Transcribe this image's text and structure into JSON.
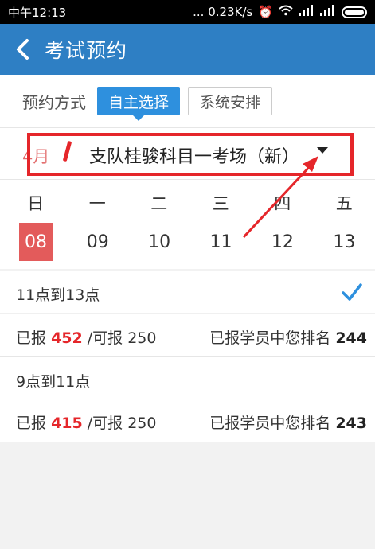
{
  "status_bar": {
    "time": "中午12:13",
    "speed": "... 0.23K/s"
  },
  "app_bar": {
    "title": "考试预约"
  },
  "method": {
    "label": "预约方式",
    "options": [
      "自主选择",
      "系统安排"
    ],
    "selected": "自主选择"
  },
  "venue": {
    "month": "4月",
    "name": "支队桂骏科目一考场（新）"
  },
  "calendar": {
    "weekdays": [
      "日",
      "一",
      "二",
      "三",
      "四",
      "五"
    ],
    "days": [
      "08",
      "09",
      "10",
      "11",
      "12",
      "13"
    ],
    "selected_day": "08"
  },
  "slots": [
    {
      "time": "11点到13点",
      "reported_label": "已报",
      "reported": "452",
      "capacity_label": "/可报 250",
      "rank_label": "已报学员中您排名",
      "rank": "244",
      "selected": true
    },
    {
      "time": "9点到11点",
      "reported_label": "已报",
      "reported": "415",
      "capacity_label": "/可报 250",
      "rank_label": "已报学员中您排名",
      "rank": "243",
      "selected": false
    }
  ],
  "colors": {
    "app_bar": "#2e7fc4",
    "chip_active": "#2e90de",
    "highlight": "#e5262a",
    "selected_day": "#e35b5b",
    "check": "#2e90de"
  },
  "icons": {
    "back": "chevron-left-icon",
    "dropdown": "caret-down-icon",
    "check": "checkmark-icon",
    "wifi": "wifi-icon",
    "signal": "signal-icon",
    "battery": "battery-icon",
    "alarm": "alarm-icon"
  }
}
